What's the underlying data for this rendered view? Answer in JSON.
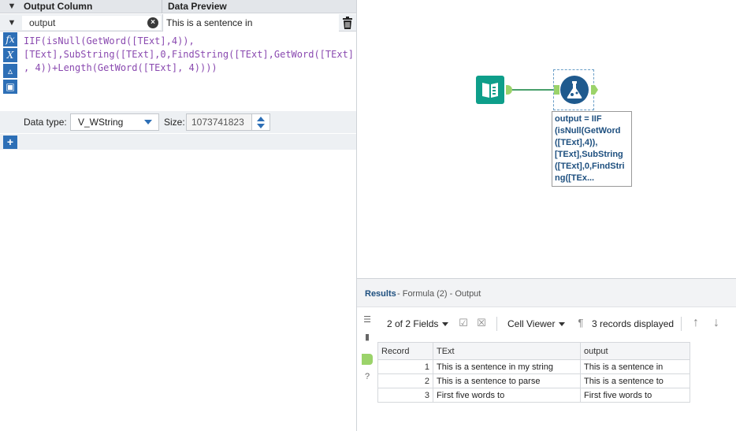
{
  "formula_panel": {
    "header": {
      "output_column": "Output Column",
      "data_preview": "Data Preview"
    },
    "field": {
      "name_value": "output",
      "preview": "This is a sentence in"
    },
    "expression_lines": [
      "IIF(isNull(GetWord([TExt],4)),",
      "[TExt],SubString([TExt],0,FindString([TExt],GetWord([TExt]",
      ", 4))+Length(GetWord([TExt], 4))))"
    ],
    "tool_icons": [
      "fx-icon",
      "variable-icon",
      "open-folder-icon",
      "save-icon"
    ],
    "data_type_label": "Data type:",
    "data_type_value": "V_WString",
    "size_label": "Size:",
    "size_value": "1073741823",
    "add_label": "+"
  },
  "canvas": {
    "annotation_lines": [
      "output = IIF",
      "(isNull(GetWord",
      "([TExt],4)),",
      "[TExt],SubString",
      "([TExt],0,FindStri",
      "ng([TEx..."
    ]
  },
  "results": {
    "title": "Results",
    "subtitle": "- Formula (2) - Output",
    "fields_label": "2 of 2 Fields",
    "cell_viewer_label": "Cell Viewer",
    "records_label": "3 records displayed",
    "columns": [
      "Record",
      "TExt",
      "output"
    ],
    "rows": [
      {
        "record": "1",
        "text": "This is a sentence in my string",
        "output": "This is a sentence in"
      },
      {
        "record": "2",
        "text": "This is a sentence to parse",
        "output": "This is a sentence to"
      },
      {
        "record": "3",
        "text": "First five words to",
        "output": "First five words to"
      }
    ]
  },
  "colors": {
    "accent_blue": "#2d6fb6",
    "anchor_green": "#9bd36a",
    "input_tool_teal": "#0e9e8a",
    "formula_tool_navy": "#1f5a8e"
  }
}
